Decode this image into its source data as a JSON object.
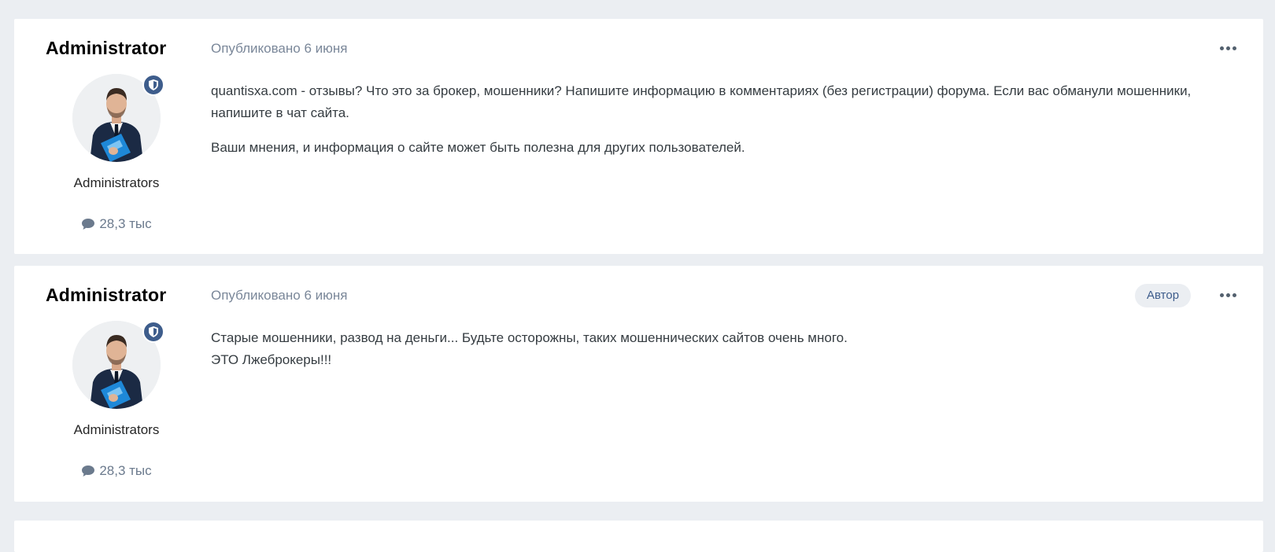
{
  "posts": [
    {
      "author": "Administrator",
      "group": "Administrators",
      "post_count": "28,3 тыс",
      "date": "Опубликовано 6 июня",
      "badge": "",
      "paragraphs": [
        "quantisxa.com - отзывы? Что это за брокер, мошенники? Напишите информацию в комментариях (без регистрации) форума. Если вас обманули мошенники, напишите в чат сайта.",
        "Ваши мнения, и информация о сайте может быть полезна для других пользователей."
      ]
    },
    {
      "author": "Administrator",
      "group": "Administrators",
      "post_count": "28,3 тыс",
      "date": "Опубликовано 6 июня",
      "badge": "Автор",
      "paragraphs": [
        "Старые мошенники, развод на деньги... Будьте осторожны, таких мошеннических сайтов очень много.",
        "ЭТО Лжеброкеры!!!"
      ]
    }
  ],
  "colors": {
    "page_bg": "#ebeef2",
    "card_bg": "#ffffff",
    "accent": "#3e5d8c",
    "meta_text": "#7a8799"
  },
  "icons": {
    "badge": "shield-icon",
    "comment": "comment-icon",
    "menu": "ellipsis-icon"
  }
}
